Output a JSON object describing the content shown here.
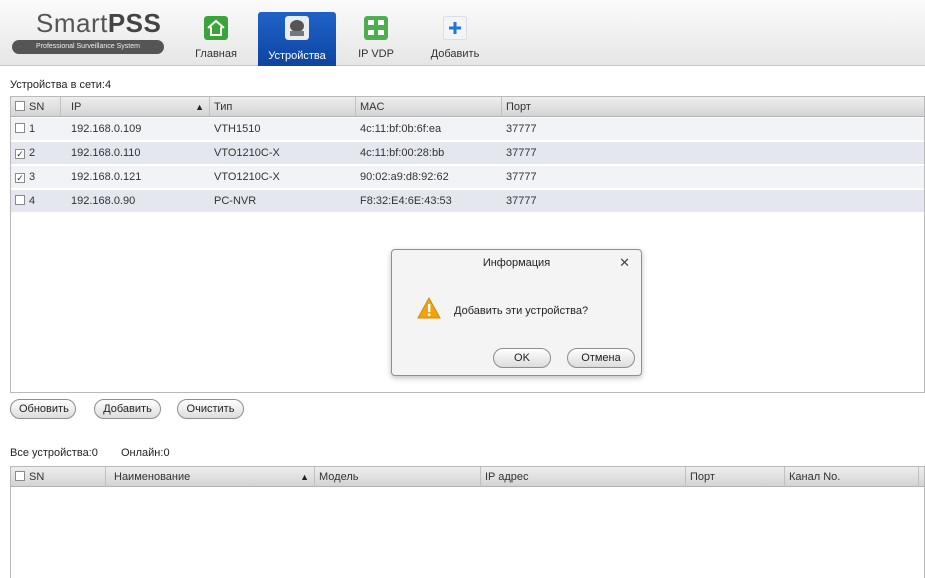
{
  "app": {
    "logo_main_light": "Smart",
    "logo_main_bold": "PSS",
    "logo_sub": "Professional Surveillance System"
  },
  "nav": {
    "tabs": [
      {
        "label": "Главная",
        "icon": "home-icon"
      },
      {
        "label": "Устройства",
        "icon": "devices-icon",
        "active": true
      },
      {
        "label": "IP VDP",
        "icon": "ip-vdp-icon"
      },
      {
        "label": "Добавить",
        "icon": "plus-icon"
      }
    ]
  },
  "online_devices": {
    "title": "Устройства в сети:4",
    "columns": [
      "SN",
      "IP",
      "Тип",
      "MAC",
      "Порт"
    ],
    "rows": [
      {
        "sn": "1",
        "checked": false,
        "ip": "192.168.0.109",
        "type": "VTH1510",
        "mac": "4c:11:bf:0b:6f:ea",
        "port": "37777"
      },
      {
        "sn": "2",
        "checked": true,
        "ip": "192.168.0.110",
        "type": "VTO1210C-X",
        "mac": "4c:11:bf:00:28:bb",
        "port": "37777"
      },
      {
        "sn": "3",
        "checked": true,
        "ip": "192.168.0.121",
        "type": "VTO1210C-X",
        "mac": "90:02:a9:d8:92:62",
        "port": "37777"
      },
      {
        "sn": "4",
        "checked": false,
        "ip": "192.168.0.90",
        "type": "PC-NVR",
        "mac": "F8:32:E4:6E:43:53",
        "port": "37777"
      }
    ],
    "buttons": {
      "refresh": "Обновить",
      "add": "Добавить",
      "clear": "Очистить"
    }
  },
  "all_devices": {
    "title": "Все устройства:0",
    "online": "Онлайн:0",
    "columns": [
      "SN",
      "Наименование",
      "Модель",
      "IP адрес",
      "Порт",
      "Канал No."
    ]
  },
  "dialog": {
    "title": "Информация",
    "message": "Добавить эти устройства?",
    "ok": "OK",
    "cancel": "Отмена"
  },
  "colors": {
    "active_tab": "#1a5bc0",
    "warning": "#f2a20c"
  }
}
